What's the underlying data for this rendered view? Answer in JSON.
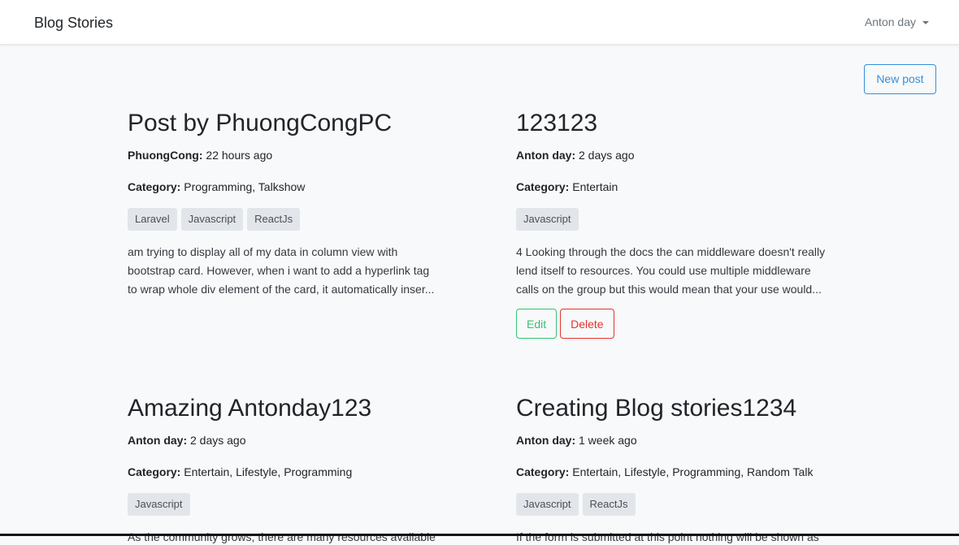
{
  "navbar": {
    "brand": "Blog Stories",
    "user": "Anton day"
  },
  "actions": {
    "new_post": "New post"
  },
  "labels": {
    "category": "Category:",
    "edit": "Edit",
    "delete": "Delete"
  },
  "posts": [
    {
      "title": "Post by PhuongCongPC",
      "author": "PhuongCong:",
      "time": "22 hours ago",
      "categories": "Programming, Talkshow",
      "tags": [
        "Laravel",
        "Javascript",
        "ReactJs"
      ],
      "excerpt": [
        "am trying to display all of my data in column view with",
        "bootstrap card. However, when i want to add a hyperlink tag",
        "to wrap whole div element of the card, it automatically inser..."
      ]
    },
    {
      "title": "123123",
      "author": "Anton day:",
      "time": "2 days ago",
      "categories": "Entertain",
      "tags": [
        "Javascript"
      ],
      "excerpt": [
        "4 Looking through the docs the can middleware doesn't really",
        "lend itself to resources. You could use multiple middleware",
        "calls on the group but this would mean that your use would..."
      ]
    },
    {
      "title": "Amazing Antonday123",
      "author": "Anton day:",
      "time": "2 days ago",
      "categories": "Entertain, Lifestyle, Programming",
      "tags": [
        "Javascript"
      ],
      "excerpt": [
        "As the community grows, there are many resources available"
      ]
    },
    {
      "title": "Creating Blog stories1234",
      "author": "Anton day:",
      "time": "1 week ago",
      "categories": "Entertain, Lifestyle, Programming, Random Talk",
      "tags": [
        "Javascript",
        "ReactJs"
      ],
      "excerpt": [
        "If the form is submitted at this point nothing will be shown as"
      ]
    }
  ]
}
